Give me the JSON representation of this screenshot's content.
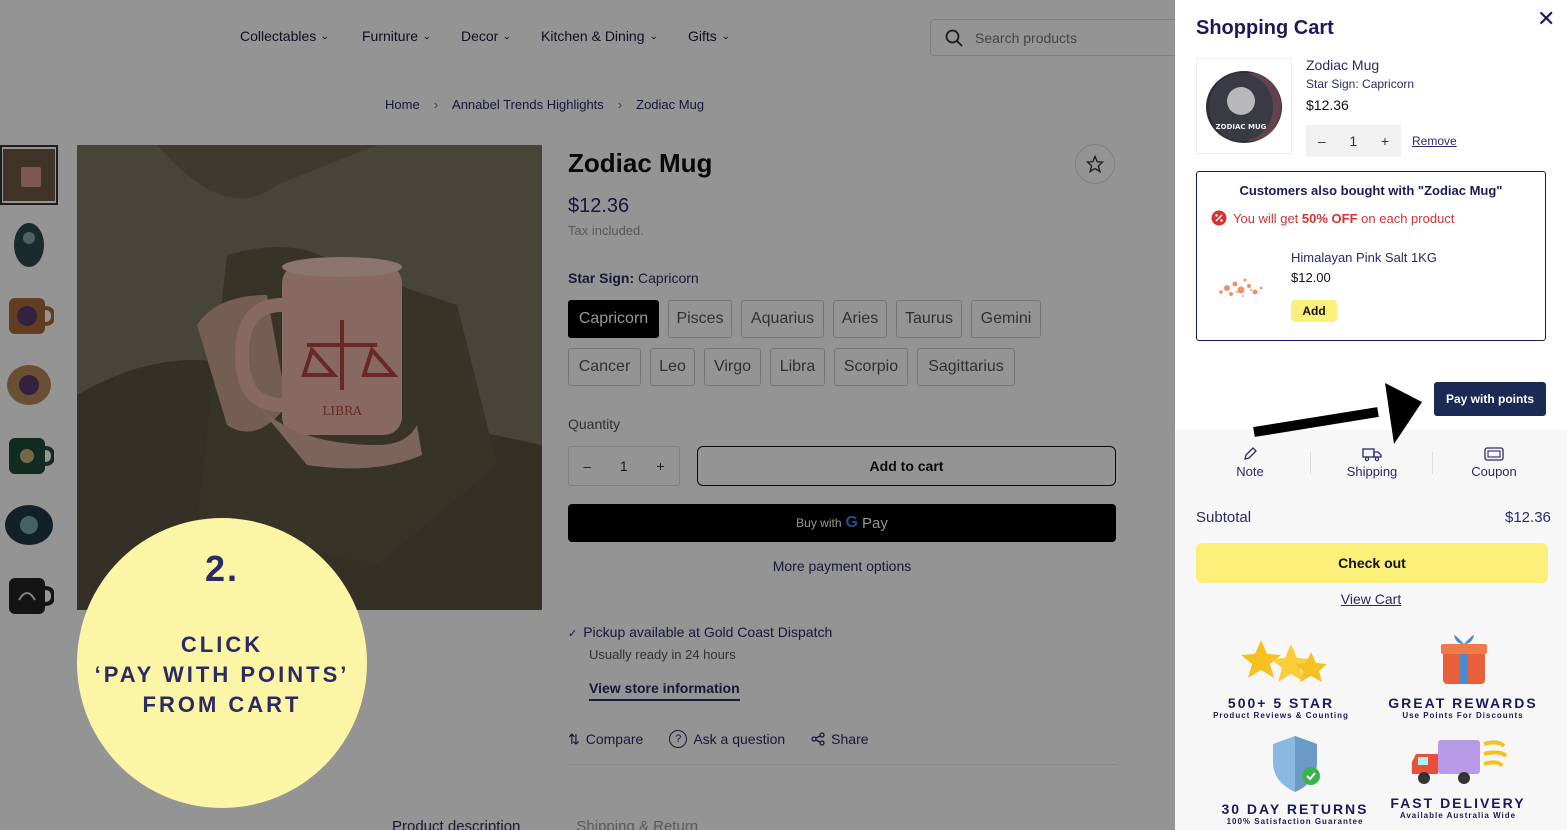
{
  "nav": {
    "items": [
      "Collectables",
      "Furniture",
      "Decor",
      "Kitchen & Dining",
      "Gifts"
    ],
    "search_placeholder": "Search products"
  },
  "breadcrumb": [
    "Home",
    "Annabel Trends Highlights",
    "Zodiac Mug"
  ],
  "product": {
    "title": "Zodiac Mug",
    "price": "$12.36",
    "tax": "Tax included.",
    "variant_label": "Star Sign:",
    "variant_value": "Capricorn",
    "options": [
      "Capricorn",
      "Pisces",
      "Aquarius",
      "Aries",
      "Taurus",
      "Gemini",
      "Cancer",
      "Leo",
      "Virgo",
      "Libra",
      "Scorpio",
      "Sagittarius"
    ],
    "selected_option": "Capricorn",
    "quantity_label": "Quantity",
    "quantity": "1",
    "add_to_cart": "Add to cart",
    "buy_with": "Buy with",
    "gpay_g": "G",
    "gpay_pay": "Pay",
    "more_payment": "More payment options",
    "pickup": "Pickup available at Gold Coast Dispatch",
    "ready": "Usually ready in 24 hours",
    "store_info": "View store information",
    "actions": [
      "Compare",
      "Ask a question",
      "Share"
    ],
    "tabs": [
      "Product description",
      "Shipping & Return"
    ],
    "mug_text": "LIBRA"
  },
  "callout": {
    "number": "2.",
    "line1": "CLICK",
    "line2": "‘PAY WITH POINTS’",
    "line3": "FROM CART"
  },
  "cart": {
    "title": "Shopping Cart",
    "item": {
      "name": "Zodiac Mug",
      "variant": "Star Sign: Capricorn",
      "price": "$12.36",
      "quantity": "1",
      "minus": "–",
      "plus": "+",
      "remove": "Remove",
      "image_text": "ZODIAC MUG"
    },
    "upsell": {
      "heading": "Customers also bought with \"Zodiac Mug\"",
      "offer_pre": "You will get",
      "offer_bold": "50% OFF",
      "offer_post": "on each product",
      "product_name": "Himalayan Pink Salt 1KG",
      "product_price": "$12.00",
      "add": "Add"
    },
    "pay_with_points": "Pay with points",
    "tools": [
      "Note",
      "Shipping",
      "Coupon"
    ],
    "subtotal_label": "Subtotal",
    "subtotal_value": "$12.36",
    "checkout": "Check out",
    "view_cart": "View Cart",
    "badges": [
      {
        "title": "500+ 5 STAR",
        "sub": "Product Reviews & Counting"
      },
      {
        "title": "GREAT REWARDS",
        "sub": "Use Points For Discounts"
      },
      {
        "title": "30 DAY RETURNS",
        "sub": "100% Satisfaction Guarantee"
      },
      {
        "title": "FAST DELIVERY",
        "sub": "Available Australia Wide"
      }
    ]
  },
  "colors": {
    "navy": "#1a2a55",
    "yellow": "#fdf07a",
    "callout": "#fdf5a6",
    "offer_red": "#d93030"
  }
}
